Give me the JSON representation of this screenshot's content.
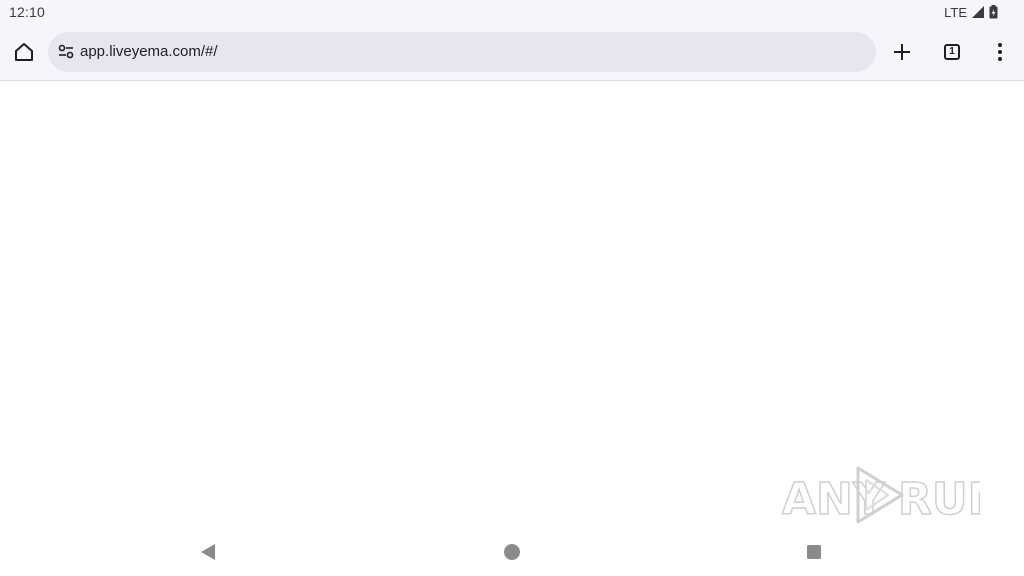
{
  "status_bar": {
    "time": "12:10",
    "network": "LTE",
    "icons": [
      "signal-icon",
      "battery-icon"
    ]
  },
  "browser": {
    "url": "app.liveyema.com/#/",
    "tab_count": "1",
    "icons": [
      "home-icon",
      "site-info-icon",
      "plus-icon",
      "tab-switcher-icon",
      "more-vert-icon"
    ]
  },
  "watermark": {
    "text_left": "ANY",
    "text_right": "RUN"
  },
  "navigation": {
    "icons": [
      "back-icon",
      "home-circle-icon",
      "recents-icon"
    ]
  },
  "colors": {
    "chrome_bg": "#f7f5fc",
    "omnibox_bg": "#e7e5ee",
    "icon": "#1f1f1f",
    "nav_icon": "#8a8a8a"
  }
}
